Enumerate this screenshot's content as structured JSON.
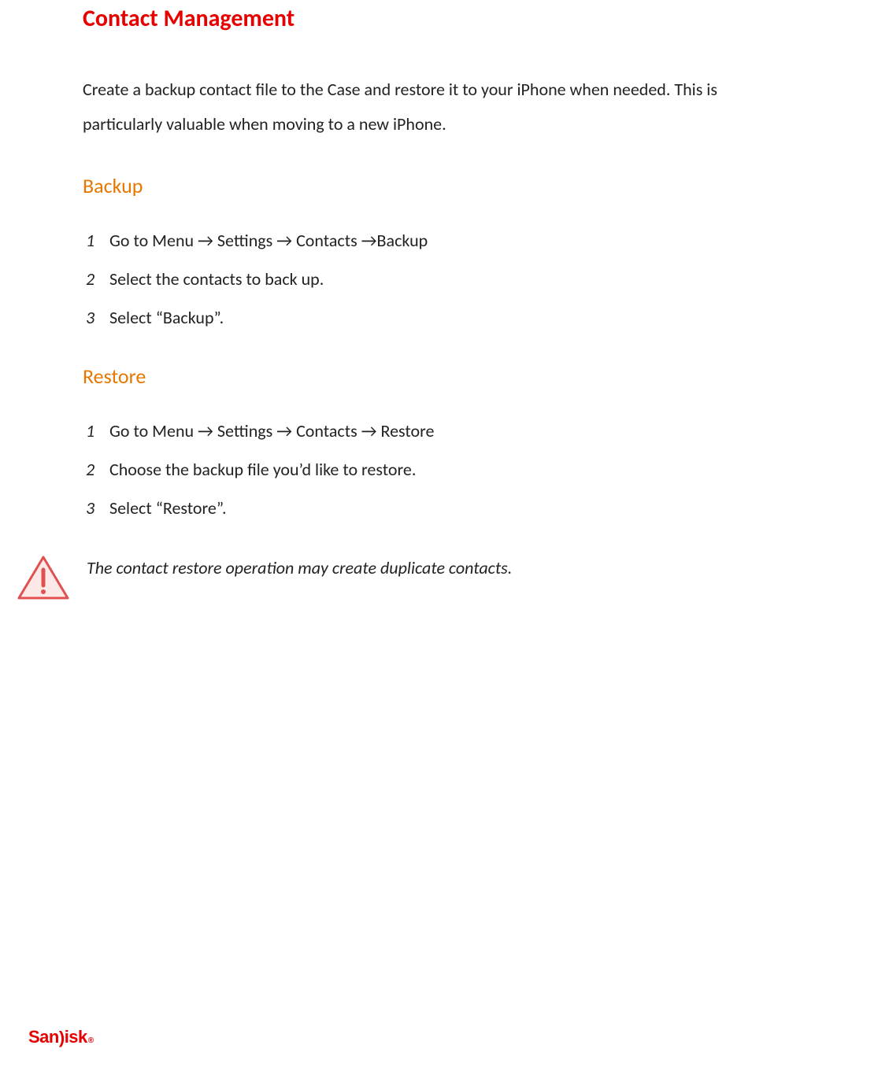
{
  "title": "Contact Management",
  "intro": "Create a backup contact file to the Case and restore it to your iPhone when needed. This is particularly valuable when moving to a new iPhone.",
  "sections": {
    "backup": {
      "heading": "Backup",
      "steps": [
        "Go to Menu → Settings → Contacts →Backup",
        "Select the contacts to back up.",
        "Select “Backup”."
      ]
    },
    "restore": {
      "heading": "Restore",
      "steps": [
        "Go to Menu → Settings → Contacts → Restore",
        "Choose the backup file you’d like to restore.",
        "Select “Restore”."
      ]
    }
  },
  "warning": "The contact restore operation may create duplicate contacts.",
  "brand": "SanDisk",
  "colors": {
    "title_red": "#e60000",
    "section_orange": "#e67700"
  }
}
